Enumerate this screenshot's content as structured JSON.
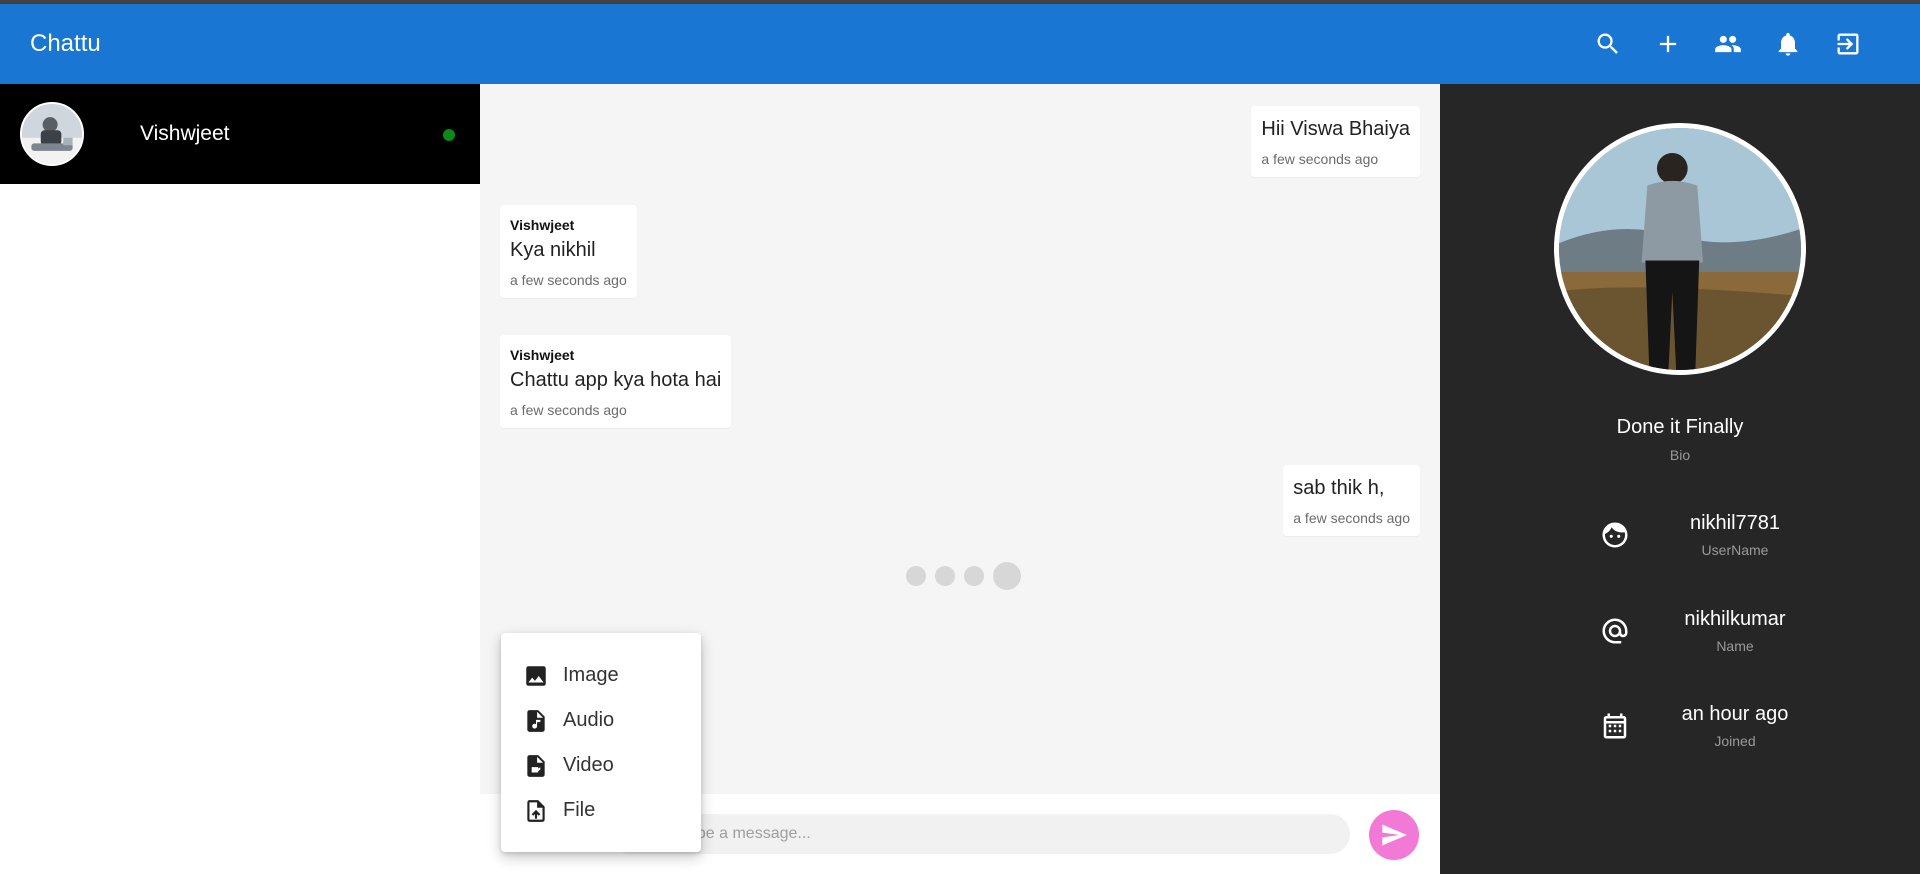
{
  "app": {
    "title": "Chattu"
  },
  "toolbar": {
    "icons": [
      "search-icon",
      "add-icon",
      "group-icon",
      "notifications-icon",
      "logout-icon"
    ]
  },
  "sidebar": {
    "contacts": [
      {
        "name": "Vishwjeet",
        "online": true
      }
    ]
  },
  "chat": {
    "messages": [
      {
        "own": true,
        "sender": "",
        "text": "Hii Viswa Bhaiya",
        "time": "a few seconds ago"
      },
      {
        "own": false,
        "sender": "Vishwjeet",
        "text": "Kya nikhil",
        "time": "a few seconds ago"
      },
      {
        "own": false,
        "sender": "Vishwjeet",
        "text": "Chattu app kya hota hai",
        "time": "a few seconds ago"
      },
      {
        "own": true,
        "sender": "",
        "text": "sab thik h,",
        "time": "a few seconds ago"
      }
    ],
    "typing_indicator": true,
    "input": {
      "placeholder": "Type a message...",
      "value": ""
    },
    "attach_menu": {
      "items": [
        {
          "label": "Image",
          "icon": "image-icon"
        },
        {
          "label": "Audio",
          "icon": "audio-file-icon"
        },
        {
          "label": "Video",
          "icon": "video-file-icon"
        },
        {
          "label": "File",
          "icon": "upload-file-icon"
        }
      ]
    }
  },
  "profile": {
    "bio": "Done it Finally",
    "bio_label": "Bio",
    "username": "nikhil7781",
    "username_label": "UserName",
    "name": "nikhilkumar",
    "name_label": "Name",
    "joined": "an hour ago",
    "joined_label": "Joined"
  },
  "colors": {
    "appbar": "#1976d2",
    "send_button": "#f27ad6",
    "online": "#0a8a18",
    "profile_bg": "#262626"
  }
}
